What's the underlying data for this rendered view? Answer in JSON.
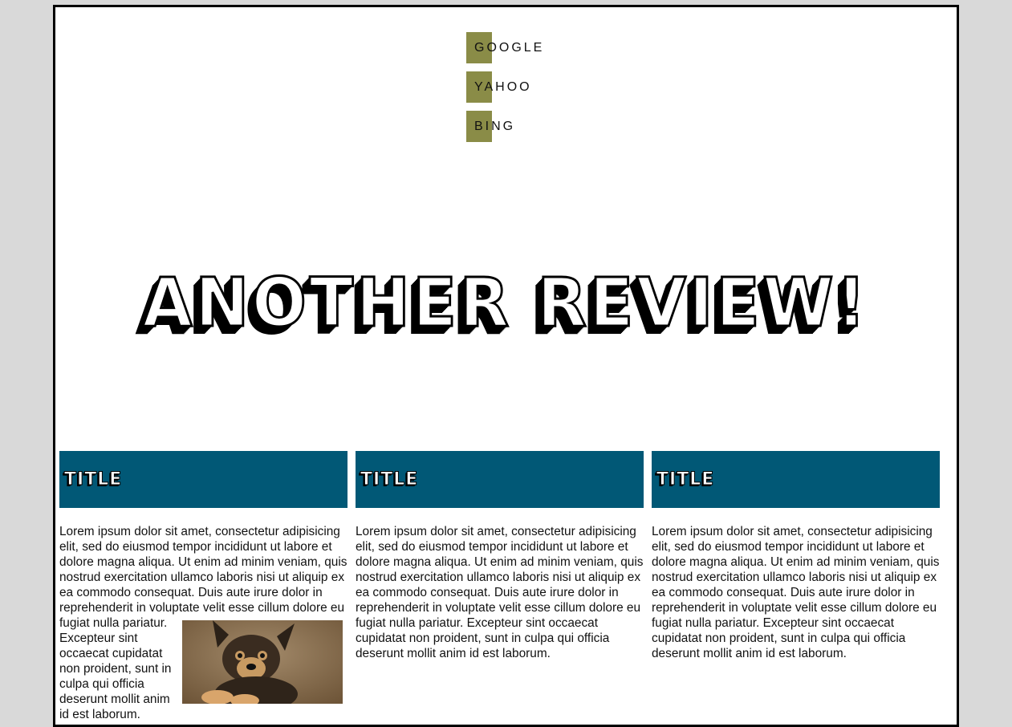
{
  "nav": {
    "items": [
      {
        "label": "GOOGLE"
      },
      {
        "label": "YAHOO"
      },
      {
        "label": "BING"
      }
    ],
    "swatch_color": "#8a8c47"
  },
  "hero": {
    "title": "ANOTHER REVIEW!"
  },
  "cards": [
    {
      "title": "TITLE",
      "body_before_image": "Lorem ipsum dolor sit amet, consectetur adipisicing elit, sed do eiusmod tempor incididunt ut labore et dolore magna aliqua. Ut enim ad minim veniam, quis nostrud exercitation ullamco laboris nisi ut aliquip ex ea commodo consequat. Duis aute irure dolor in reprehenderit in voluptate",
      "body_after_image": "velit esse cillum dolore eu fugiat nulla pariatur. Excepteur sint occaecat cupidatat non proident, sunt in culpa qui officia deserunt mollit anim id est laborum.",
      "image": "puppy-photo"
    },
    {
      "title": "TITLE",
      "body": "Lorem ipsum dolor sit amet, consectetur adipisicing elit, sed do eiusmod tempor incididunt ut labore et dolore magna aliqua. Ut enim ad minim veniam, quis nostrud exercitation ullamco laboris nisi ut aliquip ex ea commodo consequat. Duis aute irure dolor in reprehenderit in voluptate velit esse cillum dolore eu fugiat nulla pariatur. Excepteur sint occaecat cupidatat non proident, sunt in culpa qui officia deserunt mollit anim id est laborum."
    },
    {
      "title": "TITLE",
      "body": "Lorem ipsum dolor sit amet, consectetur adipisicing elit, sed do eiusmod tempor incididunt ut labore et dolore magna aliqua. Ut enim ad minim veniam, quis nostrud exercitation ullamco laboris nisi ut aliquip ex ea commodo consequat. Duis aute irure dolor in reprehenderit in voluptate velit esse cillum dolore eu fugiat nulla pariatur. Excepteur sint occaecat cupidatat non proident, sunt in culpa qui officia deserunt mollit anim id est laborum."
    }
  ],
  "colors": {
    "card_header": "#015876",
    "page_background": "#d9d9d9"
  }
}
